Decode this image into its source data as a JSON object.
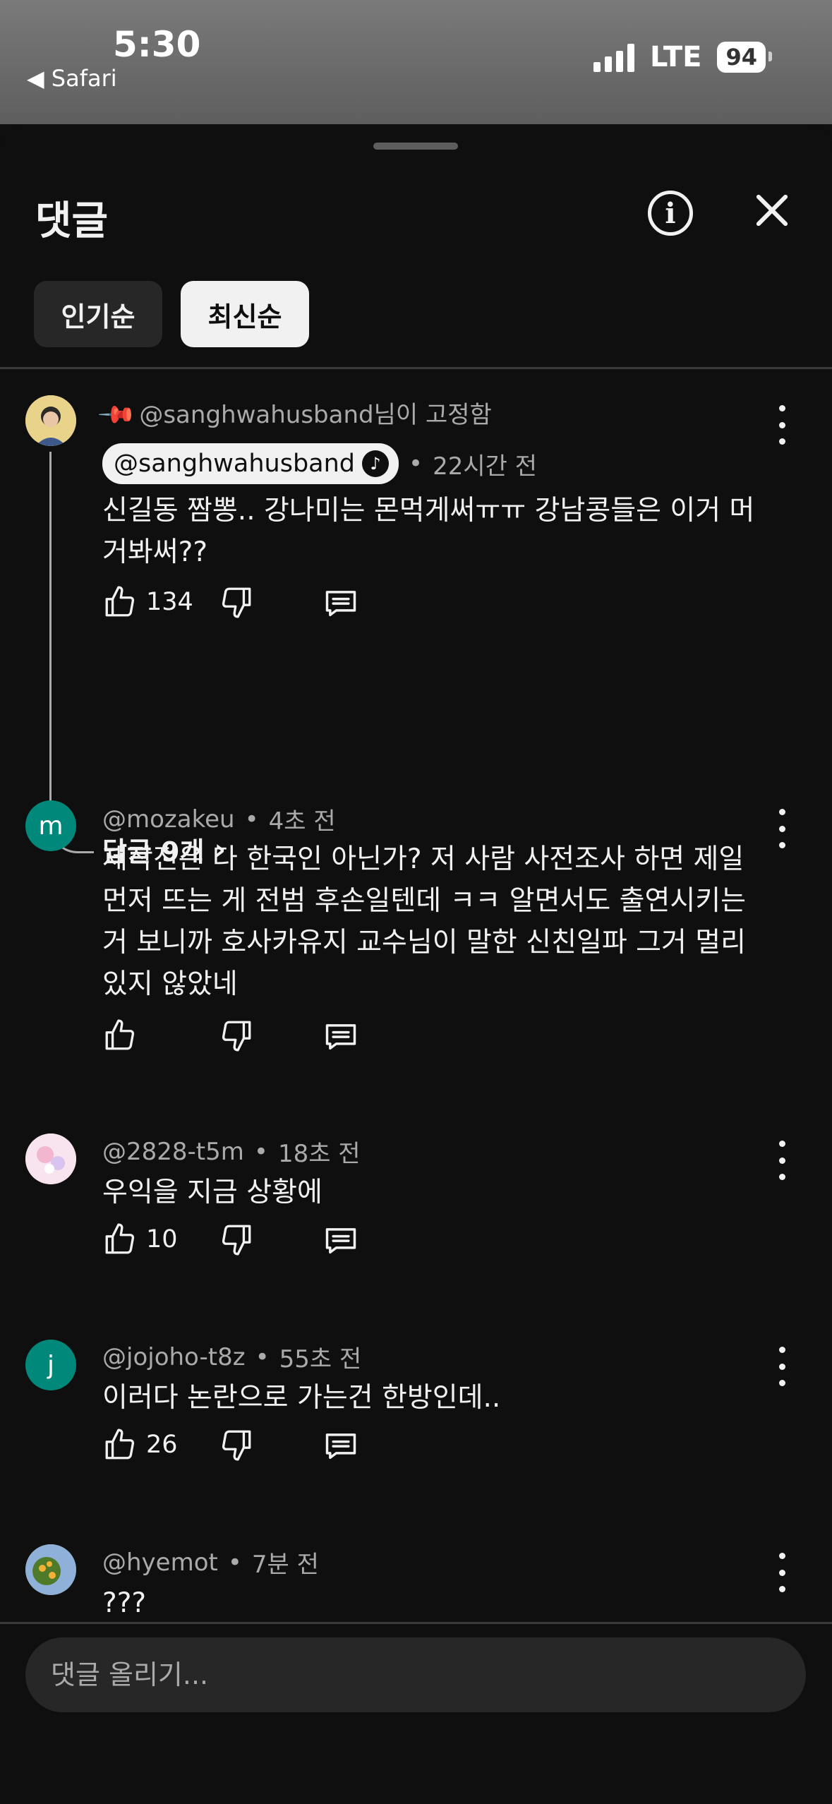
{
  "status_bar": {
    "time": "5:30",
    "back_app": "◀ Safari",
    "network": "LTE",
    "battery": "94"
  },
  "sheet": {
    "title": "댓글"
  },
  "sort_tabs": [
    {
      "label": "인기순"
    },
    {
      "label": "최신순"
    }
  ],
  "comments": [
    {
      "pinned_label": "@sanghwahusband님이 고정함",
      "author": "@sanghwahusband",
      "time": "22시간 전",
      "text": "신길동 짬뽕.. 강나미는 몬먹게써ㅠㅠ 강남콩들은 이거 머거봐써??",
      "likes": "134",
      "replies_label": "답글 9개",
      "avatar_color": "#d9c27a"
    },
    {
      "author": "@mozakeu",
      "time": "4초 전",
      "text": "제작진은 다 한국인 아닌가? 저 사람 사전조사 하면 제일 먼저 뜨는 게 전범 후손일텐데 ㅋㅋ 알면서도 출연시키는 거 보니까 호사카유지 교수님이 말한 신친일파 그거 멀리 있지 않았네",
      "likes": "",
      "avatar_letter": "m",
      "avatar_color": "#00897b"
    },
    {
      "author": "@2828-t5m",
      "time": "18초 전",
      "text": "우익을 지금 상황에",
      "likes": "10",
      "avatar_color": "#f3d6e4"
    },
    {
      "author": "@jojoho-t8z",
      "time": "55초 전",
      "text": "이러다 논란으로 가는건 한방인데..",
      "likes": "26",
      "avatar_letter": "j",
      "avatar_color": "#00897b"
    },
    {
      "author": "@hyemot",
      "time": "7분 전",
      "text": "???",
      "avatar_color": "#7a9a3a"
    }
  ],
  "composer": {
    "placeholder": "댓글 올리기..."
  }
}
